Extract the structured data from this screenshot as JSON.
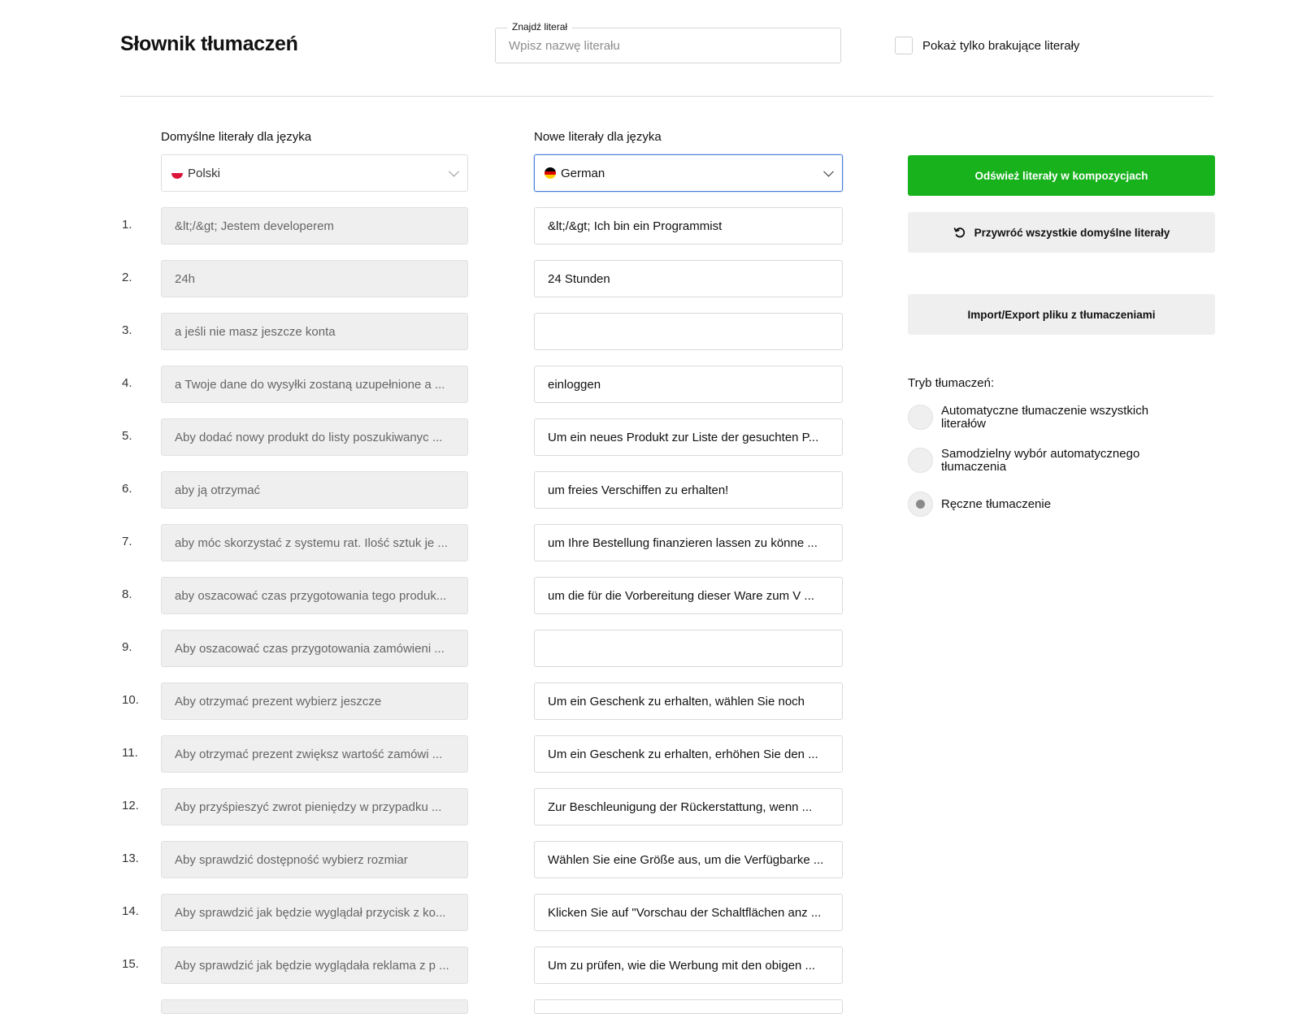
{
  "header": {
    "title": "Słownik tłumaczeń",
    "search_label": "Znajdź literał",
    "search_placeholder": "Wpisz nazwę literału",
    "search_value": "",
    "missing_only_label": "Pokaż tylko brakujące literały"
  },
  "columns": {
    "source_header": "Domyślne literały dla języka",
    "target_header": "Nowe literały dla języka",
    "source_language": "Polski",
    "target_language": "German"
  },
  "rows": [
    {
      "num": "1.",
      "source": "&lt;/&gt; Jestem developerem",
      "target": "&lt;/&gt; Ich bin ein Programmist"
    },
    {
      "num": "2.",
      "source": "24h",
      "target": "24 Stunden"
    },
    {
      "num": "3.",
      "source": "a jeśli nie masz jeszcze konta",
      "target": ""
    },
    {
      "num": "4.",
      "source": "a Twoje dane do wysyłki zostaną uzupełnione a ...",
      "target": "einloggen"
    },
    {
      "num": "5.",
      "source": "Aby dodać nowy produkt do listy poszukiwanyc ...",
      "target": "Um ein neues Produkt zur Liste der gesuchten P..."
    },
    {
      "num": "6.",
      "source": "aby ją otrzymać",
      "target": "um freies Verschiffen zu erhalten!"
    },
    {
      "num": "7.",
      "source": "aby móc skorzystać z systemu rat. Ilość sztuk je ...",
      "target": "um Ihre Bestellung finanzieren lassen zu könne ..."
    },
    {
      "num": "8.",
      "source": "aby oszacować czas przygotowania tego produk...",
      "target": "um die für die Vorbereitung dieser Ware zum V ..."
    },
    {
      "num": "9.",
      "source": "Aby oszacować czas przygotowania zamówieni ...",
      "target": ""
    },
    {
      "num": "10.",
      "source": "Aby otrzymać prezent wybierz jeszcze",
      "target": "Um ein Geschenk zu erhalten, wählen Sie noch"
    },
    {
      "num": "11.",
      "source": "Aby otrzymać prezent zwiększ wartość zamówi ...",
      "target": "Um ein Geschenk zu erhalten, erhöhen Sie den ..."
    },
    {
      "num": "12.",
      "source": "Aby przyśpieszyć zwrot pieniędzy w przypadku ...",
      "target": "Zur Beschleunigung der Rückerstattung, wenn ..."
    },
    {
      "num": "13.",
      "source": "Aby sprawdzić dostępność wybierz rozmiar",
      "target": "Wählen Sie eine Größe aus, um die Verfügbarke ..."
    },
    {
      "num": "14.",
      "source": "Aby sprawdzić jak będzie wyglądał przycisk z ko...",
      "target": "Klicken Sie auf \"Vorschau der Schaltflächen anz ..."
    },
    {
      "num": "15.",
      "source": "Aby sprawdzić jak będzie wyglądała reklama z p ...",
      "target": "Um zu prüfen, wie die Werbung mit den obigen ..."
    },
    {
      "num": "",
      "source": "",
      "target": ""
    }
  ],
  "actions": {
    "refresh_label": "Odśwież literały w kompozycjach",
    "restore_label": "Przywróć wszystkie domyślne literały",
    "restore_icon": "undo-icon",
    "import_export_label": "Import/Export pliku z tłumaczeniami"
  },
  "translation_mode": {
    "title": "Tryb tłumaczeń:",
    "options": [
      {
        "label": "Automatyczne tłumaczenie wszystkich literałów",
        "checked": false
      },
      {
        "label": "Samodzielny wybór automatycznego tłumaczenia",
        "checked": false
      },
      {
        "label": "Ręczne tłumaczenie",
        "checked": true
      }
    ]
  },
  "colors": {
    "accent_green": "#17b21c",
    "focus_blue": "#4a7fd9",
    "flag_pl": [
      "#ffffff",
      "#dc143c"
    ],
    "flag_de": [
      "#000000",
      "#dd0000",
      "#ffce00"
    ]
  }
}
